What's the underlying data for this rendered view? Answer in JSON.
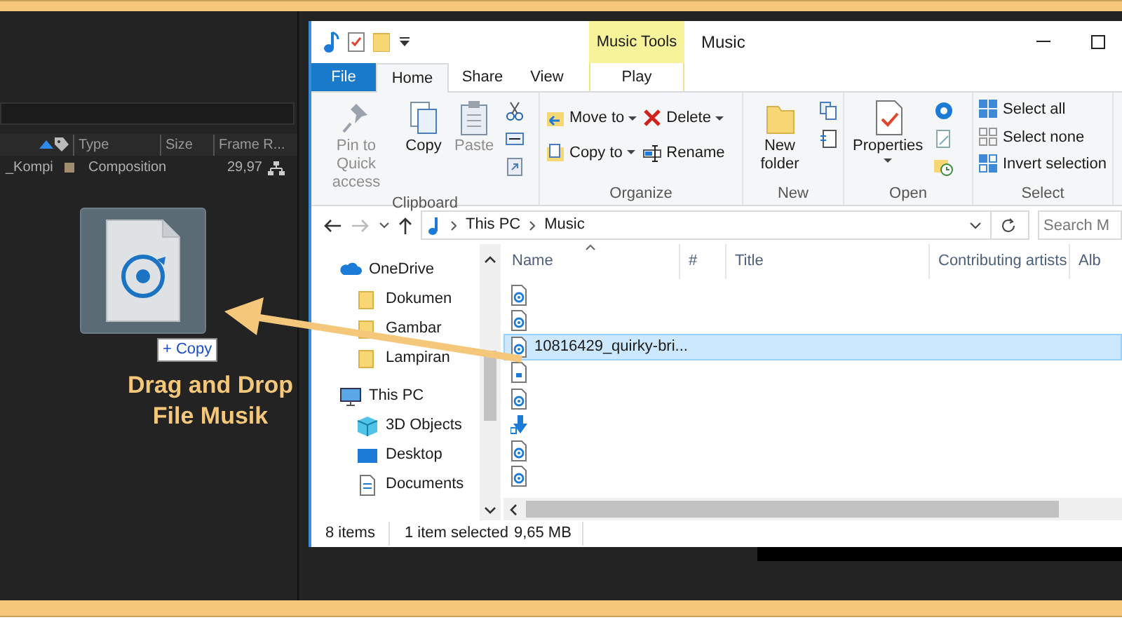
{
  "project_panel": {
    "columns": [
      {
        "label": "Type"
      },
      {
        "label": "Size"
      },
      {
        "label": "Frame R..."
      }
    ],
    "rows": [
      {
        "name": "_Kompi",
        "color": "#a08c6e",
        "type": "Composition",
        "frame_rate": "29,97"
      }
    ]
  },
  "drag": {
    "badge": "+ Copy",
    "caption": [
      "Drag and Drop",
      "File Musik"
    ]
  },
  "explorer": {
    "title": "Music",
    "contextual_tab": "Music Tools",
    "tabs": [
      {
        "label": "File",
        "kind": "file",
        "selected": false
      },
      {
        "label": "Home",
        "kind": "tab",
        "selected": true
      },
      {
        "label": "Share",
        "kind": "tab",
        "selected": false
      },
      {
        "label": "View",
        "kind": "tab",
        "selected": false
      },
      {
        "label": "Play",
        "kind": "contextual",
        "selected": false
      }
    ],
    "ribbon_groups": [
      {
        "label": "Clipboard",
        "buttons": [
          {
            "kind": "large",
            "label": "Pin to Quick access",
            "disabled": true
          },
          {
            "kind": "large",
            "label": "Copy",
            "disabled": false
          },
          {
            "kind": "large",
            "label": "Paste",
            "disabled": true
          },
          {
            "kind": "icons"
          }
        ]
      },
      {
        "label": "Organize",
        "buttons": [
          {
            "kind": "small",
            "label": "Move to",
            "dropdown": true
          },
          {
            "kind": "small",
            "label": "Copy to",
            "dropdown": true
          },
          {
            "kind": "small",
            "label": "Delete",
            "dropdown": true
          },
          {
            "kind": "small",
            "label": "Rename",
            "dropdown": false
          }
        ]
      },
      {
        "label": "New",
        "buttons": [
          {
            "kind": "large",
            "label": "New folder",
            "disabled": false
          },
          {
            "kind": "icons"
          }
        ]
      },
      {
        "label": "Open",
        "buttons": [
          {
            "kind": "large",
            "label": "Properties",
            "disabled": false,
            "dropdown": true
          },
          {
            "kind": "icons"
          }
        ]
      },
      {
        "label": "Select",
        "buttons": [
          {
            "kind": "small",
            "label": "Select all",
            "dropdown": false
          },
          {
            "kind": "small",
            "label": "Select none",
            "dropdown": false
          },
          {
            "kind": "small",
            "label": "Invert selection",
            "dropdown": false
          }
        ]
      }
    ],
    "address": {
      "path": [
        "This PC",
        "Music"
      ]
    },
    "search": {
      "placeholder": "Search M"
    },
    "nav": [
      {
        "label": "OneDrive",
        "kind": "cloud",
        "children": [
          {
            "label": "Dokumen",
            "kind": "folder"
          },
          {
            "label": "Gambar",
            "kind": "folder"
          },
          {
            "label": "Lampiran",
            "kind": "folder"
          }
        ]
      },
      {
        "label": "This PC",
        "kind": "pc",
        "children": [
          {
            "label": "3D Objects",
            "kind": "objects"
          },
          {
            "label": "Desktop",
            "kind": "desktop"
          },
          {
            "label": "Documents",
            "kind": "documents"
          }
        ]
      }
    ],
    "columns": [
      "Name",
      "#",
      "Title",
      "Contributing artists",
      "Alb"
    ],
    "files": [
      {
        "kind": "audio",
        "selected": false
      },
      {
        "kind": "audio",
        "selected": false
      },
      {
        "kind": "audio",
        "selected": true,
        "name": "10816429_quirky-bri..."
      },
      {
        "kind": "document",
        "selected": false
      },
      {
        "kind": "audio",
        "selected": false
      },
      {
        "kind": "shortcut",
        "selected": false
      },
      {
        "kind": "audio",
        "selected": false
      },
      {
        "kind": "audio",
        "selected": false
      }
    ],
    "status": [
      "8 items",
      "1 item selected",
      "9,65 MB"
    ]
  }
}
